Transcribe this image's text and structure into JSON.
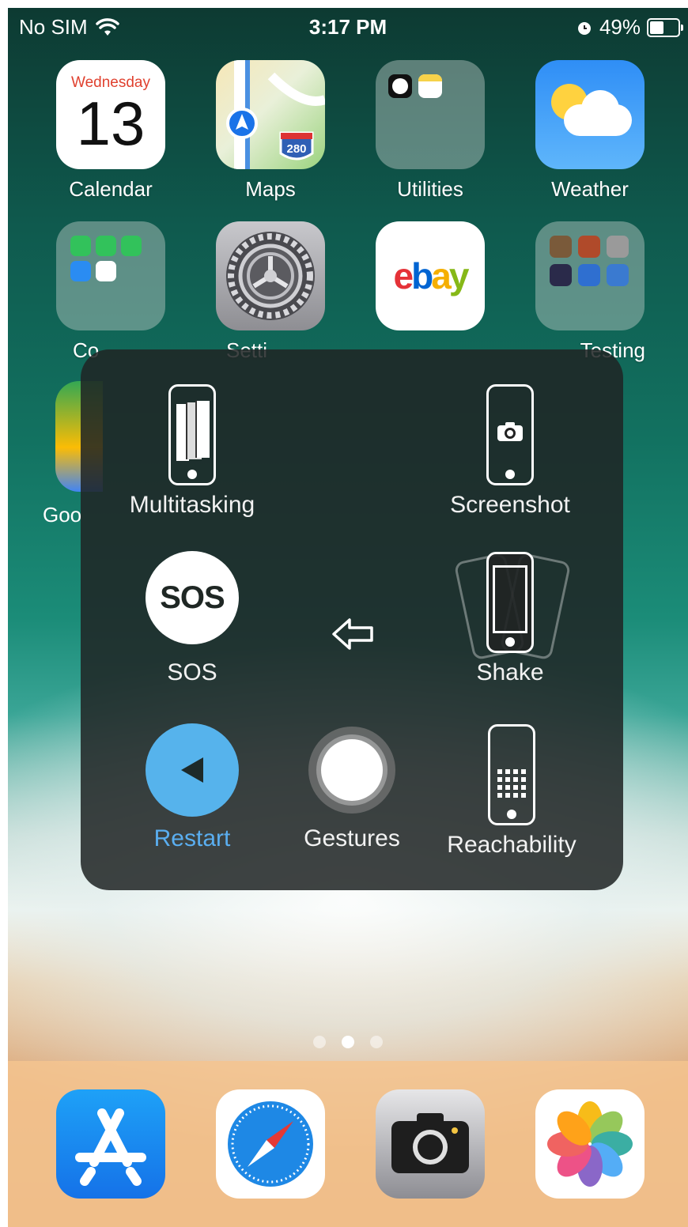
{
  "status": {
    "carrier": "No SIM",
    "time": "3:17 PM",
    "battery": "49%"
  },
  "home": {
    "row1": [
      {
        "label": "Calendar",
        "cal_day": "Wednesday",
        "cal_num": "13"
      },
      {
        "label": "Maps",
        "badge": "280"
      },
      {
        "label": "Utilities"
      },
      {
        "label": "Weather"
      }
    ],
    "row2": [
      {
        "label": "Co"
      },
      {
        "label": "Setti"
      },
      {
        "label": "ebay",
        "logo": "ebay"
      },
      {
        "label": "Testing"
      }
    ],
    "row3_partial": "Goo"
  },
  "menu": {
    "items": {
      "multitasking": "Multitasking",
      "screenshot": "Screenshot",
      "sos": "SOS",
      "sos_glyph": "SOS",
      "shake": "Shake",
      "restart": "Restart",
      "gestures": "Gestures",
      "reachability": "Reachability"
    }
  },
  "page_dots": {
    "count": 3,
    "active_index": 1
  },
  "dock": {
    "apps": [
      "App Store",
      "Safari",
      "Camera",
      "Photos"
    ]
  },
  "colors": {
    "restart_accent": "#56b3ec",
    "calendar_red": "#e0412f"
  }
}
